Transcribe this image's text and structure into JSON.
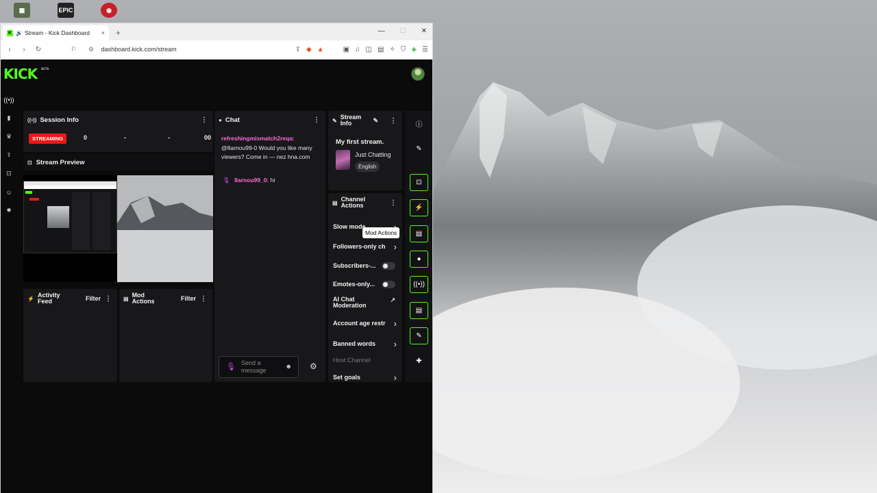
{
  "desktop": {
    "icons": [
      {
        "name": "app-icon-1",
        "glyph": "▦",
        "caption": "",
        "color": "#5a6d4f"
      },
      {
        "name": "epic-games-icon",
        "glyph": "EPIC",
        "caption": "",
        "color": "#222222"
      },
      {
        "name": "app-icon-3",
        "glyph": "◉",
        "caption": "",
        "color": "#c8202a"
      }
    ]
  },
  "browser": {
    "tab_title": "Stream - Kick Dashboard",
    "tab_close": "×",
    "new_tab": "+",
    "window_controls": {
      "minimize": "—",
      "maximize": "☐",
      "close": "✕"
    },
    "url": "dashboard.kick.com/stream"
  },
  "kick": {
    "logo": "KICK",
    "logo_badge": "BETA",
    "session_info": {
      "title": "Session Info",
      "status": "STREAMING",
      "stats": [
        "0",
        "-",
        "-",
        "00"
      ]
    },
    "stream_preview": {
      "title": "Stream Preview"
    },
    "activity_feed": {
      "title_line1": "Activity",
      "title_line2": "Feed",
      "filter": "Filter"
    },
    "mod_actions": {
      "title_line1": "Mod",
      "title_line2": "Actions",
      "filter": "Filter"
    },
    "chat": {
      "title": "Chat",
      "messages": [
        {
          "user": "refreshingmismatch2reqa:",
          "text": "@8arnou99-0 Would you like many viewers? Come in — nez hna.com"
        },
        {
          "user": "8arnou99_0:",
          "text": " hi"
        }
      ],
      "input_placeholder_line1": "Send a",
      "input_placeholder_line2": "message"
    },
    "stream_info": {
      "title_line1": "Stream",
      "title_line2": "Info",
      "stream_title": "My first stream.",
      "category": "Just Chatting",
      "language": "English"
    },
    "channel_actions": {
      "title_line1": "Channel",
      "title_line2": "Actions",
      "items": [
        {
          "label": "Slow mode",
          "control": "chevron"
        },
        {
          "label": "Followers-only ch",
          "control": "chevron"
        },
        {
          "label": "Subscribers-...",
          "control": "toggle"
        },
        {
          "label": "Emotes-only...",
          "control": "toggle"
        },
        {
          "label_line1": "AI Chat",
          "label_line2": "Moderation",
          "control": "external"
        },
        {
          "label": "Account age restr",
          "control": "chevron"
        },
        {
          "label": "Banned words",
          "control": "chevron"
        },
        {
          "label": "Host Channel",
          "control": "none"
        },
        {
          "label": "Set goals",
          "control": "chevron"
        }
      ]
    },
    "tooltip": "Mod Actions",
    "accent_color": "#53fc18",
    "streaming_color": "#e91916"
  }
}
